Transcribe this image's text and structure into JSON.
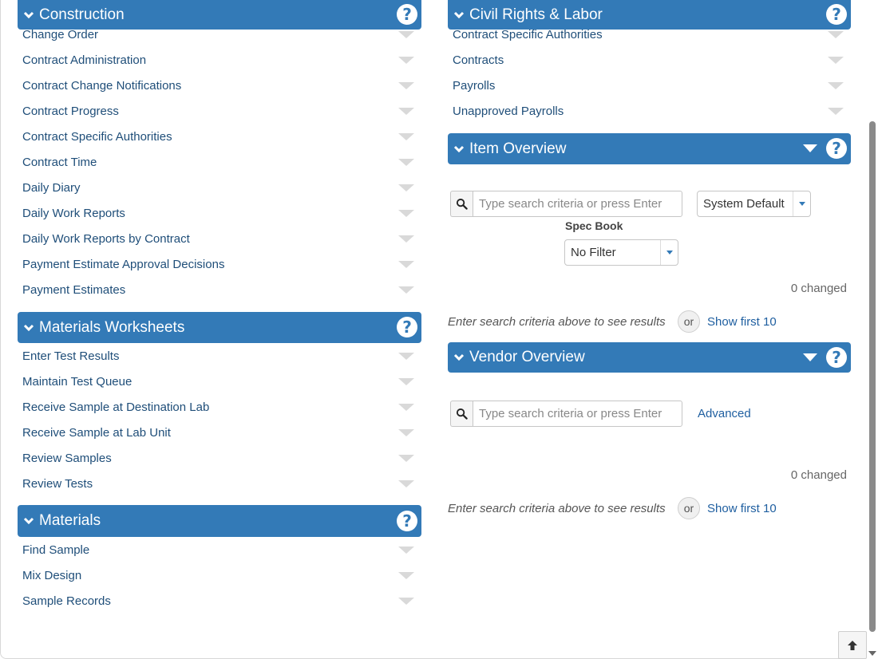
{
  "left": {
    "construction": {
      "title": "Construction",
      "items": [
        "Change Order",
        "Contract Administration",
        "Contract Change Notifications",
        "Contract Progress",
        "Contract Specific Authorities",
        "Contract Time",
        "Daily Diary",
        "Daily Work Reports",
        "Daily Work Reports by Contract",
        "Payment Estimate Approval Decisions",
        "Payment Estimates"
      ]
    },
    "materials_worksheets": {
      "title": "Materials Worksheets",
      "items": [
        "Enter Test Results",
        "Maintain Test Queue",
        "Receive Sample at Destination Lab",
        "Receive Sample at Lab Unit",
        "Review Samples",
        "Review Tests"
      ]
    },
    "materials": {
      "title": "Materials",
      "items": [
        "Find Sample",
        "Mix Design",
        "Sample Records"
      ]
    }
  },
  "right": {
    "civil_rights": {
      "title": "Civil Rights & Labor",
      "items": [
        "Contract Specific Authorities",
        "Contracts",
        "Payrolls",
        "Unapproved Payrolls"
      ]
    },
    "item_overview": {
      "title": "Item Overview",
      "search_placeholder": "Type search criteria or press Enter",
      "view_select": "System Default",
      "spec_book_label": "Spec Book",
      "spec_book_select": "No Filter",
      "changed": "0 changed",
      "hint": "Enter search criteria above to see results",
      "or": "or",
      "show_first": "Show first 10"
    },
    "vendor_overview": {
      "title": "Vendor Overview",
      "search_placeholder": "Type search criteria or press Enter",
      "advanced": "Advanced",
      "changed": "0 changed",
      "hint": "Enter search criteria above to see results",
      "or": "or",
      "show_first": "Show first 10"
    }
  },
  "icons": {
    "help": "question-circle-icon",
    "collapse": "chevron-down-icon",
    "search": "search-icon",
    "back_to_top": "arrow-up-icon"
  },
  "colors": {
    "header": "#337ab7",
    "link": "#1f4e79"
  }
}
